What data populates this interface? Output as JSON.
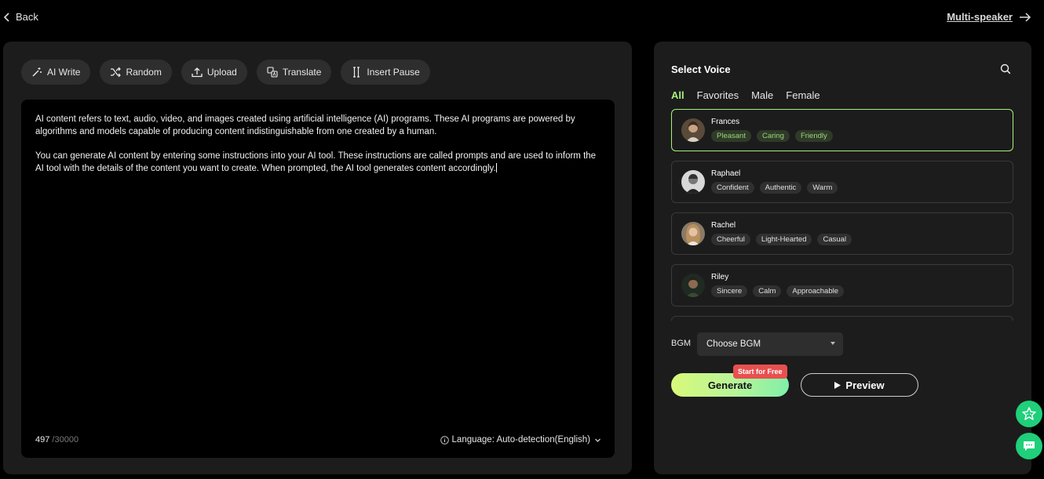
{
  "nav": {
    "back_label": "Back",
    "multi_label": "Multi-speaker"
  },
  "toolbar": {
    "ai_write": "AI Write",
    "random": "Random",
    "upload": "Upload",
    "translate": "Translate",
    "insert_pause": "Insert Pause"
  },
  "editor": {
    "paragraph1": "AI content refers to text, audio, video, and images created using artificial intelligence (AI) programs. These AI programs are powered by algorithms and models capable of producing content indistinguishable from one created by a human.",
    "paragraph2": "You can generate AI content by entering some instructions into your AI tool. These instructions are called prompts and are used to inform the AI tool with the details of the content you want to create. When prompted, the AI tool generates content accordingly.",
    "char_count": "497",
    "char_max": " /30000",
    "language": "Language: Auto-detection(English)"
  },
  "voice_panel": {
    "title": "Select Voice",
    "tabs": [
      "All",
      "Favorites",
      "Male",
      "Female"
    ],
    "voices": [
      {
        "name": "Frances",
        "tags": [
          "Pleasant",
          "Caring",
          "Friendly"
        ]
      },
      {
        "name": "Raphael",
        "tags": [
          "Confident",
          "Authentic",
          "Warm"
        ]
      },
      {
        "name": "Rachel",
        "tags": [
          "Cheerful",
          "Light-Hearted",
          "Casual"
        ]
      },
      {
        "name": "Riley",
        "tags": [
          "Sincere",
          "Calm",
          "Approachable"
        ]
      }
    ],
    "bgm_label": "BGM",
    "bgm_value": "Choose BGM",
    "generate_label": "Generate",
    "free_badge": "Start for Free",
    "preview_label": "Preview"
  },
  "colors": {
    "accent": "#a6f27a",
    "panel": "#1c1c1c",
    "badge": "#e8504f",
    "fab": "#1fcf7a"
  }
}
